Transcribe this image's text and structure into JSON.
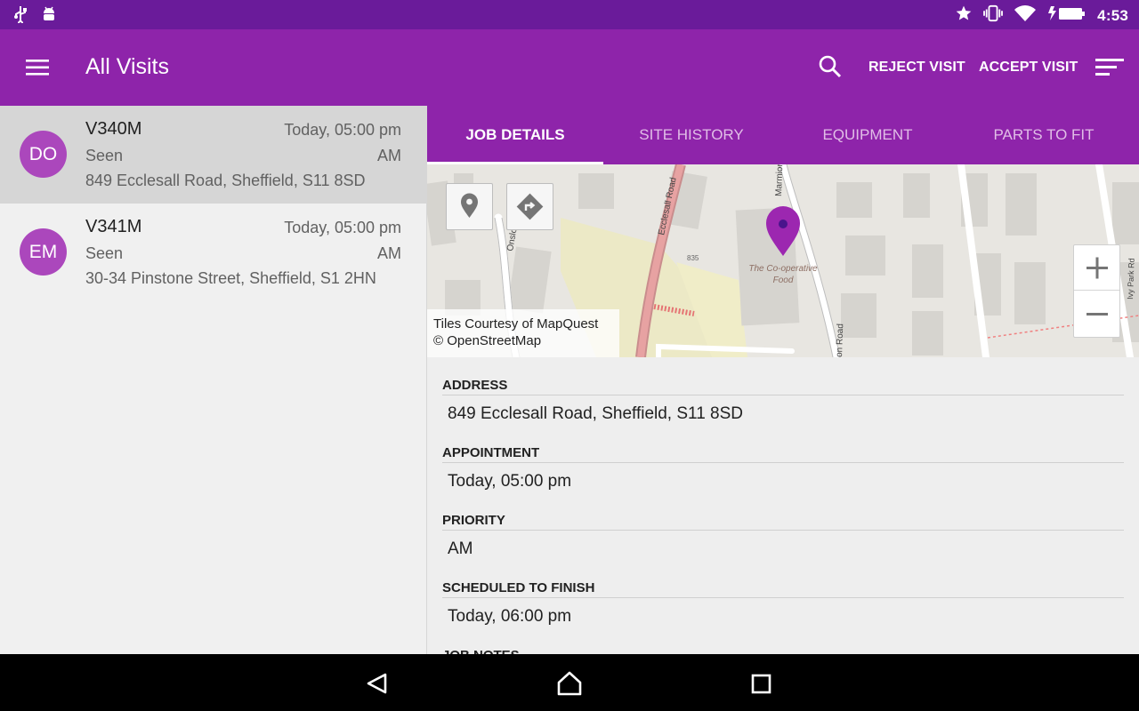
{
  "status_bar": {
    "time": "4:53",
    "icons": [
      "usb-icon",
      "android-icon",
      "star-icon",
      "vibrate-icon",
      "wifi-icon",
      "battery-charging-icon"
    ]
  },
  "app_bar": {
    "title": "All Visits",
    "reject_label": "REJECT VISIT",
    "accept_label": "ACCEPT VISIT",
    "icons": [
      "menu-icon",
      "search-icon",
      "sort-icon"
    ],
    "color": "#8e24aa"
  },
  "visits": [
    {
      "initials": "DO",
      "code": "V340M",
      "time": "Today, 05:00 pm",
      "status": "Seen",
      "priority": "AM",
      "address": "849 Ecclesall Road, Sheffield, S11 8SD",
      "selected": true
    },
    {
      "initials": "EM",
      "code": "V341M",
      "time": "Today, 05:00 pm",
      "status": "Seen",
      "priority": "AM",
      "address": "30-34 Pinstone Street, Sheffield, S1 2HN",
      "selected": false
    }
  ],
  "tabs": [
    {
      "label": "JOB DETAILS",
      "active": true
    },
    {
      "label": "SITE HISTORY",
      "active": false
    },
    {
      "label": "EQUIPMENT",
      "active": false
    },
    {
      "label": "PARTS TO FIT",
      "active": false
    }
  ],
  "map": {
    "attribution_line1": "Tiles Courtesy of MapQuest",
    "attribution_line2": "© OpenStreetMap",
    "streets": [
      "Ecclesall Road",
      "Onslow Rd",
      "Marmion",
      "on Road",
      "835",
      "Ivy Park Rd"
    ],
    "poi": [
      "The Co-operative",
      "Food"
    ],
    "marker_color": "#9c27b0"
  },
  "details": {
    "address_label": "ADDRESS",
    "address_value": "849 Ecclesall Road, Sheffield, S11 8SD",
    "appointment_label": "APPOINTMENT",
    "appointment_value": "Today, 05:00 pm",
    "priority_label": "PRIORITY",
    "priority_value": "AM",
    "finish_label": "SCHEDULED TO FINISH",
    "finish_value": "Today, 06:00 pm",
    "notes_label": "JOB NOTES"
  },
  "nav_bar": {
    "icons": [
      "back-icon",
      "home-icon",
      "recents-icon"
    ]
  }
}
